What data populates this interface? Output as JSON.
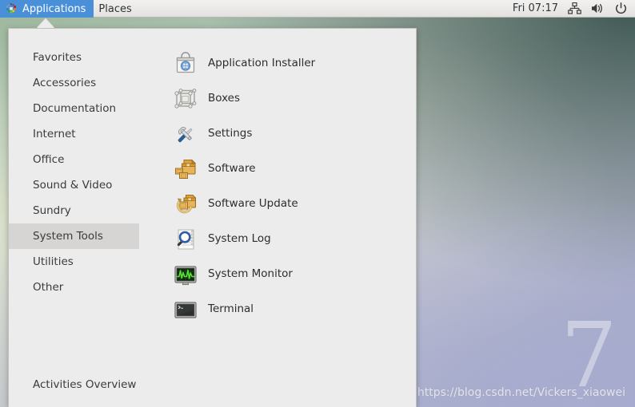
{
  "top_panel": {
    "logo_icon": "gnome-pinwheel-icon",
    "menus": [
      {
        "label": "Applications",
        "active": true
      },
      {
        "label": "Places",
        "active": false
      }
    ],
    "clock": "Fri 07:17",
    "tray": [
      {
        "name": "network-icon",
        "glyph": "network"
      },
      {
        "name": "volume-icon",
        "glyph": "volume"
      },
      {
        "name": "power-icon",
        "glyph": "power"
      }
    ]
  },
  "app_menu": {
    "categories": [
      {
        "label": "Favorites",
        "selected": false
      },
      {
        "label": "Accessories",
        "selected": false
      },
      {
        "label": "Documentation",
        "selected": false
      },
      {
        "label": "Internet",
        "selected": false
      },
      {
        "label": "Office",
        "selected": false
      },
      {
        "label": "Sound & Video",
        "selected": false
      },
      {
        "label": "Sundry",
        "selected": false
      },
      {
        "label": "System Tools",
        "selected": true
      },
      {
        "label": "Utilities",
        "selected": false
      },
      {
        "label": "Other",
        "selected": false
      }
    ],
    "activities_overview": "Activities Overview",
    "applications": [
      {
        "label": "Application Installer",
        "icon": "shopping-bag-icon"
      },
      {
        "label": "Boxes",
        "icon": "wireframe-box-icon"
      },
      {
        "label": "Settings",
        "icon": "wrench-screwdriver-icon"
      },
      {
        "label": "Software",
        "icon": "package-icon"
      },
      {
        "label": "Software Update",
        "icon": "package-refresh-icon"
      },
      {
        "label": "System Log",
        "icon": "magnifier-document-icon"
      },
      {
        "label": "System Monitor",
        "icon": "monitor-graph-icon"
      },
      {
        "label": "Terminal",
        "icon": "terminal-icon"
      }
    ]
  },
  "desktop": {
    "brand_mark": "7",
    "watermark": "https://blog.csdn.net/Vickers_xiaowei"
  },
  "colors": {
    "panel_accent": "#4a90d9",
    "panel_bg": "#ececeb",
    "menu_bg": "#edecec",
    "selection_bg": "#d6d5d4",
    "text": "#2e3436"
  }
}
